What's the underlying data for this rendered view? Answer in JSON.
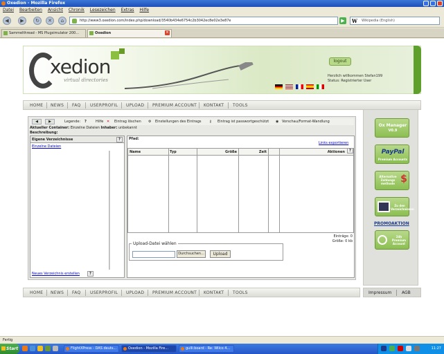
{
  "browser": {
    "title": "Oxedion - Mozilla Firefox",
    "menu": [
      "Datei",
      "Bearbeiten",
      "Ansicht",
      "Chronik",
      "Lesezeichen",
      "Extras",
      "Hilfe"
    ],
    "url": "http://www3.oxedion.com/index.php/download/3540b434e6754c2b3042ec8e02e3e87e",
    "search_placeholder": "Wikipedia (English)",
    "tabs": [
      {
        "label": "Sammelthread - MS Plugsimulator 200..."
      },
      {
        "label": "Oxedion",
        "active": true
      }
    ],
    "status": "Fertig"
  },
  "header": {
    "logo_text": "xedion",
    "logo_sub": "virtual directories",
    "logout": "logout",
    "welcome_line1": "Herzlich willkommen Stefan199",
    "welcome_line2": "Status: Registrierter User"
  },
  "nav": [
    "HOME",
    "NEWS",
    "FAQ",
    "USERPROFIL",
    "UPLOAD",
    "PREMIUM ACCOUNT",
    "KONTAKT",
    "TOOLS"
  ],
  "toolbar": {
    "legende": "Legende:",
    "hilfe": "Hilfe",
    "loeschen": "Eintrag löschen",
    "einstellungen": "Einstellungen des Eintrags",
    "passwort": "Eintrag ist passwortgeschützt",
    "vorschau": "Vorschau/Format-Wandlung"
  },
  "container": {
    "line1_label": "Aktueller Container:",
    "line1_value": "Einzelne Dateien",
    "owner_label": "Inhaber:",
    "owner_value": "unbekannt",
    "desc_label": "Beschreibung:"
  },
  "left": {
    "heading": "Eigene Verzeichnisse",
    "item": "Einzelne Dateien",
    "footer": "Neues Verzeichnis erstellen"
  },
  "right": {
    "pfad": "Pfad:",
    "links_export": "Links exportieren",
    "columns": [
      "Name",
      "Typ",
      "Größe",
      "Zeit",
      "Aktionen"
    ],
    "eintraege": "Einträge: 0",
    "groesse": "Größe: 0 kb",
    "upload_legend": "Upload-Datei wählen",
    "browse": "Durchsuchen...",
    "upload_btn": "Upload"
  },
  "sidebar": {
    "ox_manager": "Ox Manager",
    "ox_version": "V0.9",
    "paypal": "PayPal",
    "paypal_sub": "Premium Accounts",
    "alt_pay": "Alternative Zahlungs methode",
    "dollar": "$",
    "zu_den": "Zu den Verzeichnissen",
    "promo": "PROMOAKTION",
    "premium24": "24h Premium Account"
  },
  "footer": {
    "impressum": "Impressum",
    "agb": "AGB"
  },
  "taskbar": {
    "start": "Start",
    "items": [
      {
        "label": "FlightXPress - DAS deuts..."
      },
      {
        "label": "Oxedion - Mozilla Fire...",
        "active": true
      },
      {
        "label": "gulli:board - Re: Wilco 4..."
      }
    ],
    "clock": "11:27"
  },
  "colors": {
    "accent_green": "#8cbf52",
    "xp_blue": "#2556c8",
    "link_blue": "#0000cc"
  }
}
